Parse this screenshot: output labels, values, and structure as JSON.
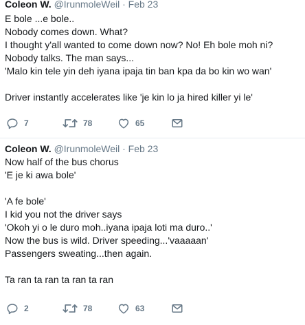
{
  "tweets": [
    {
      "author_name": "Coleon W.",
      "handle": "@IrunmoleWeil",
      "separator": "·",
      "date": "Feb 23",
      "lines": [
        "E bole ...e bole..",
        "Nobody comes down. What?",
        "I thought y'all wanted to come down now? No! Eh bole moh ni?",
        "Nobody talks. The man says...",
        "'Malo kin tele yin deh iyana ipaja tin ban kpa da bo kin wo wan'",
        "",
        "Driver instantly accelerates like 'je kin lo ja hired killer yi le'"
      ],
      "replies": "7",
      "retweets": "78",
      "likes": "65"
    },
    {
      "author_name": "Coleon W.",
      "handle": "@IrunmoleWeil",
      "separator": "·",
      "date": "Feb 23",
      "lines": [
        "Now half of the bus chorus",
        "'E je ki awa bole'",
        "",
        "'A fe bole'",
        "I kid you not the driver says",
        "'Okoh yi o le duro moh..iyana ipaja loti ma duro..'",
        "Now the bus is wild. Driver speeding...'vaaaaan'",
        "Passengers sweating...then again.",
        "",
        "Ta ran ta ran ta ran ta ran"
      ],
      "replies": "2",
      "retweets": "78",
      "likes": "63"
    }
  ],
  "icons": {
    "reply": "reply-icon",
    "retweet": "retweet-icon",
    "like": "heart-icon",
    "message": "envelope-icon"
  },
  "colors": {
    "text": "#14171a",
    "muted": "#657786",
    "divider": "#e6ecf0"
  }
}
